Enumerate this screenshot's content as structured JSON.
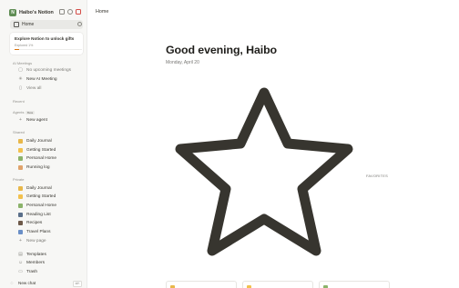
{
  "workspace": {
    "name": "Haibo's Notion",
    "logo_letter": "N"
  },
  "nav_home": "Home",
  "promo": {
    "title": "Explore Notion to unlock gifts",
    "subtitle": "Explored 1%",
    "progress": 0.07
  },
  "sections": {
    "ai_meetings": "AI Meetings",
    "recent": "Recent",
    "agents": "Agents",
    "agents_badge": "Beta",
    "shared": "Shared",
    "private": "Private"
  },
  "ai_meetings_items": [
    "No upcoming meetings",
    "New AI Meeting",
    "View all"
  ],
  "agents_items": [
    "New agent"
  ],
  "shared_items": [
    "Daily Journal",
    "Getting Started",
    "Personal Home",
    "Running log"
  ],
  "private_items": [
    "Daily Journal",
    "Getting Started",
    "Personal Home",
    "Reading List",
    "Recipes",
    "Travel Plans",
    "New page"
  ],
  "footer_items": [
    "Templates",
    "Members",
    "Trash"
  ],
  "new_chat": {
    "label": "New chat",
    "kbd": "⌘K"
  },
  "breadcrumb": "Home",
  "greeting": "Good evening, Haibo",
  "date": "Monday, April 20",
  "favorites_label": "FAVORITES",
  "colors": {
    "accent": "#d9730d",
    "star": "#37352f",
    "workspace_logo": "#5f8d54"
  }
}
